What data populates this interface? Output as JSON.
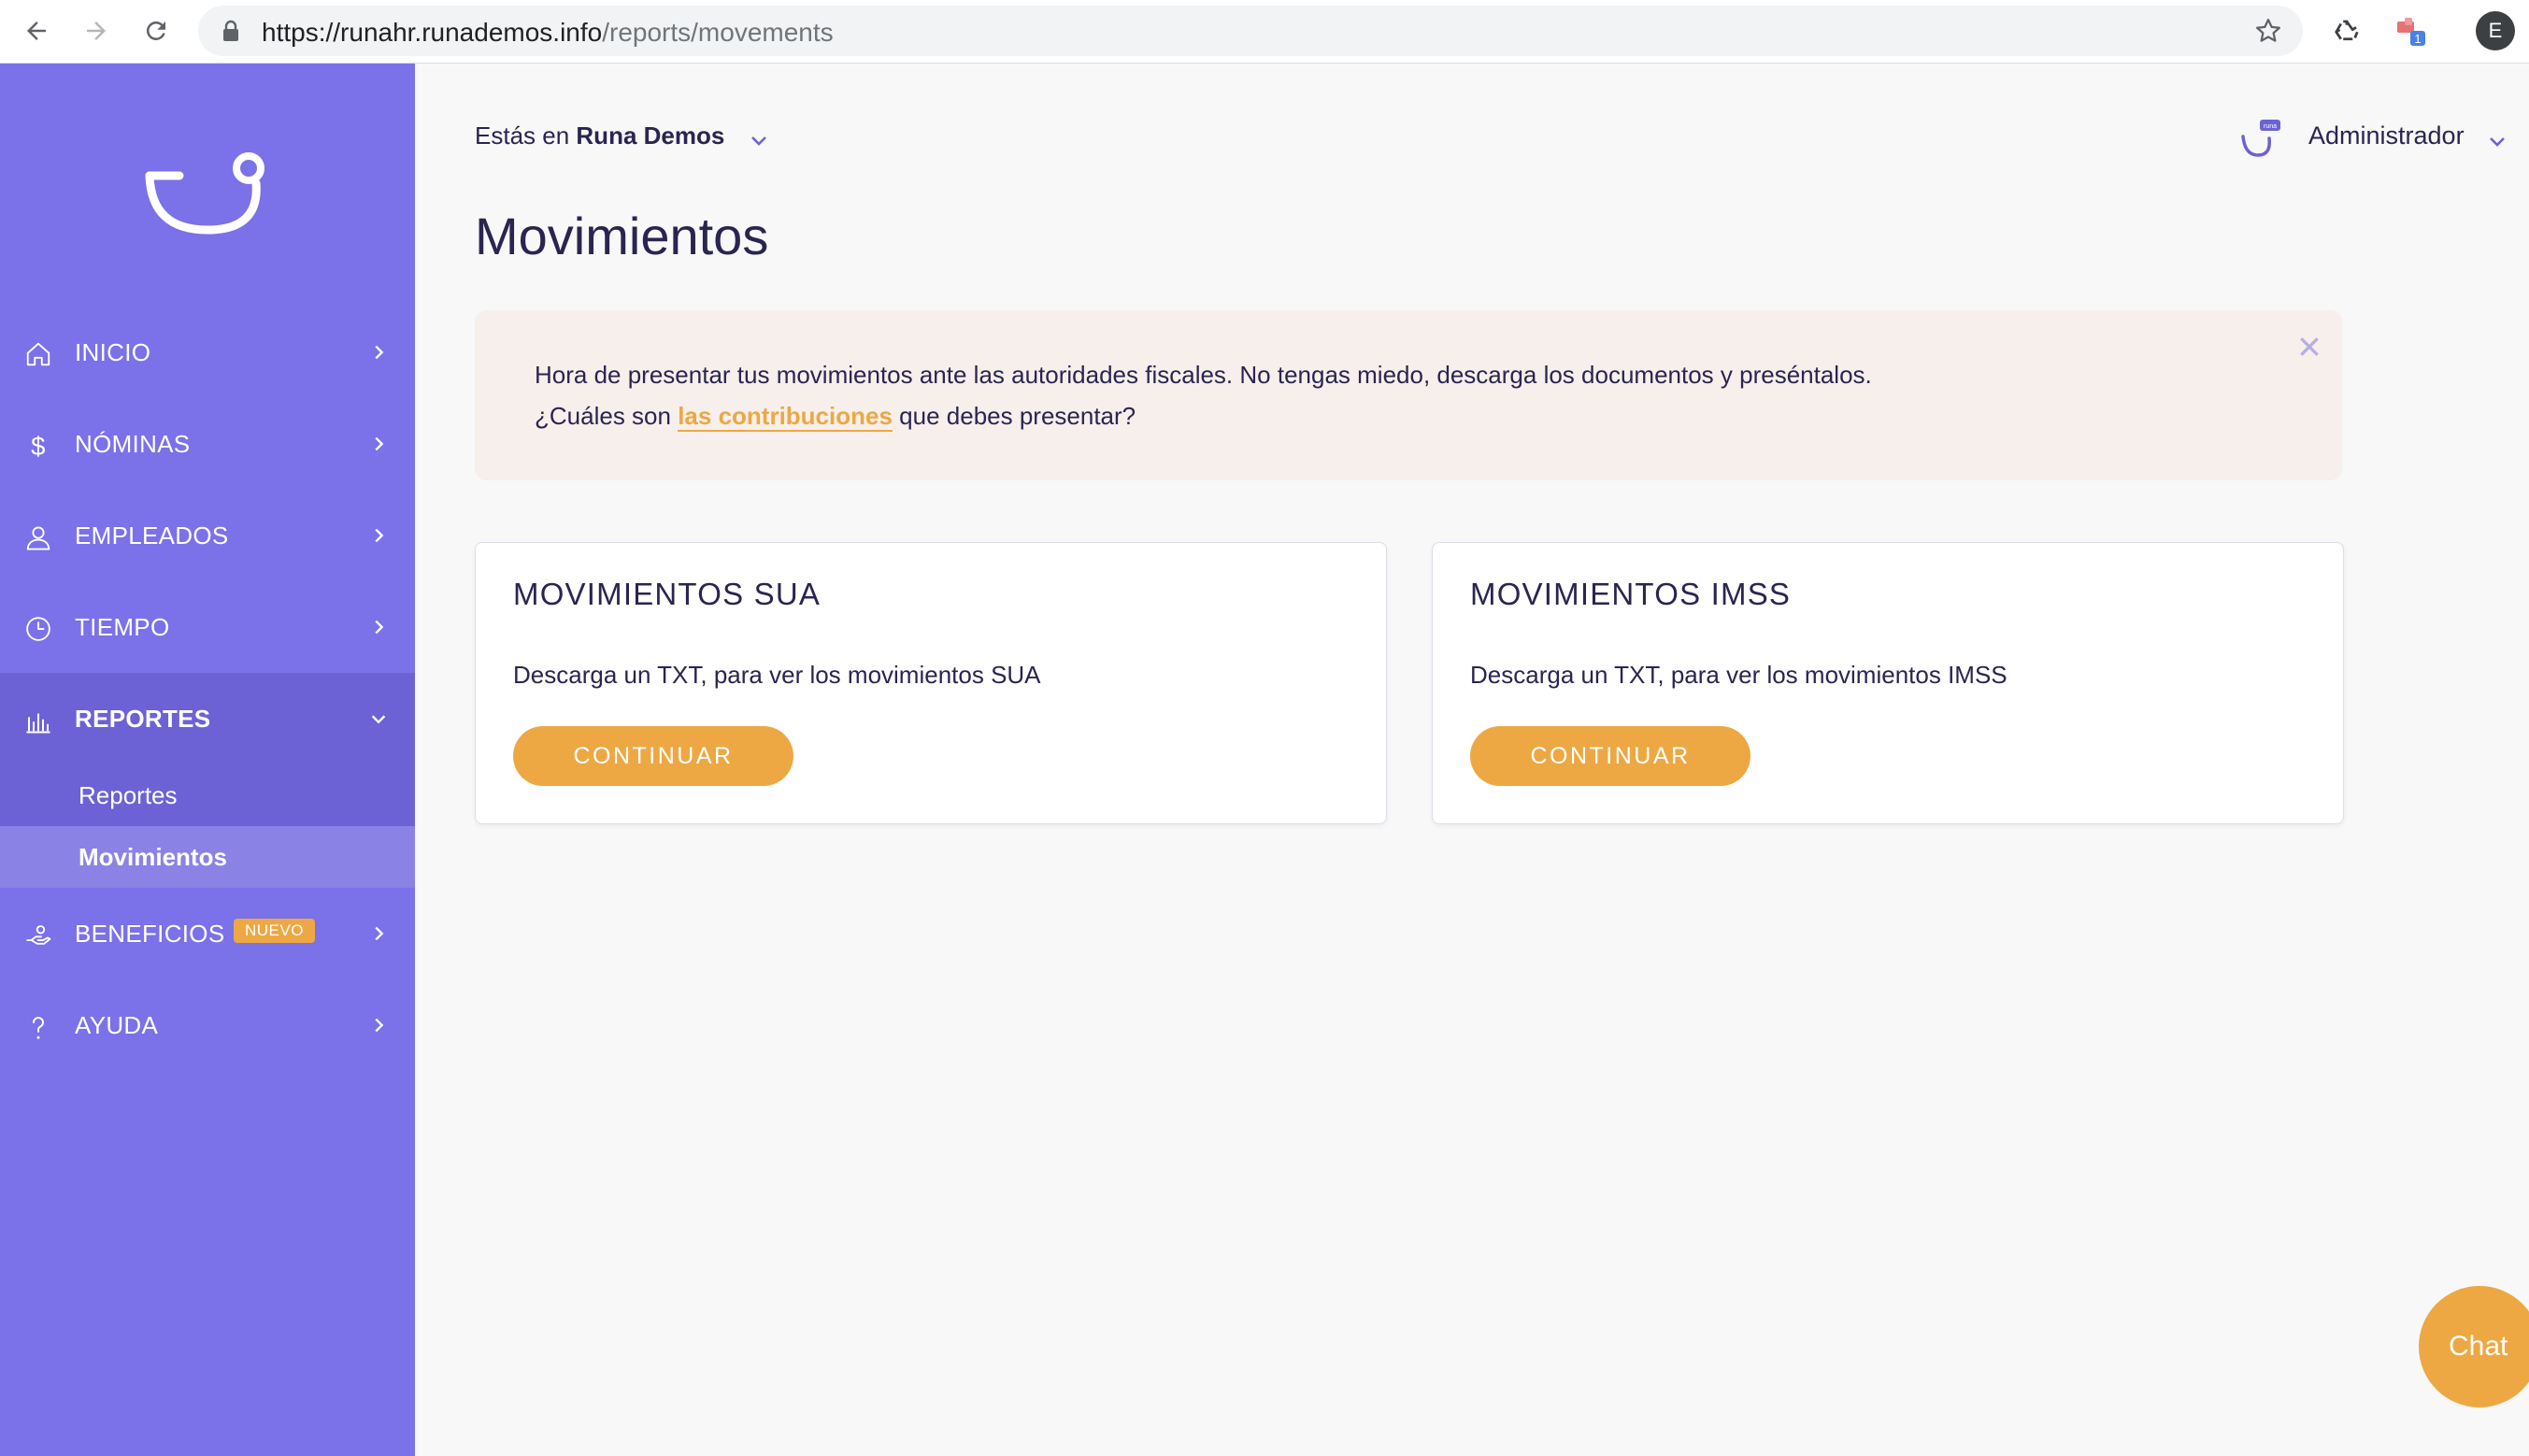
{
  "browser": {
    "url_host": "https://runahr.runademos.info",
    "url_path": "/reports/movements",
    "profile_initial": "E",
    "extension_badge": "1"
  },
  "sidebar": {
    "items": [
      {
        "label": "INICIO",
        "icon": "home-icon"
      },
      {
        "label": "NÓMINAS",
        "icon": "dollar-icon"
      },
      {
        "label": "EMPLEADOS",
        "icon": "person-icon"
      },
      {
        "label": "TIEMPO",
        "icon": "clock-icon"
      },
      {
        "label": "REPORTES",
        "icon": "bar-chart-icon",
        "expanded": true
      },
      {
        "label": "BENEFICIOS",
        "icon": "hand-icon",
        "badge": "NUEVO"
      },
      {
        "label": "AYUDA",
        "icon": "question-icon"
      }
    ],
    "reportes_sub": [
      {
        "label": "Reportes"
      },
      {
        "label": "Movimientos",
        "current": true
      }
    ]
  },
  "header": {
    "company_prefix": "Estás en",
    "company_name": "Runa Demos",
    "user_name": "Administrador"
  },
  "main": {
    "title": "Movimientos",
    "alert": {
      "line1": "Hora de presentar tus movimientos ante las autoridades fiscales. No tengas miedo, descarga los documentos y preséntalos.",
      "line2_prefix": "¿Cuáles son",
      "line2_link": "las contribuciones",
      "line2_suffix": "que debes presentar?"
    },
    "cards": [
      {
        "title": "MOVIMIENTOS SUA",
        "description": "Descarga un TXT, para ver los movimientos SUA",
        "button": "CONTINUAR"
      },
      {
        "title": "MOVIMIENTOS IMSS",
        "description": "Descarga un TXT, para ver los movimientos IMSS",
        "button": "CONTINUAR"
      }
    ]
  },
  "chat": {
    "label": "Chat"
  },
  "colors": {
    "sidebar": "#7b71e9",
    "sidebar_active": "#6c62d6",
    "accent": "#eda843",
    "text": "#2a2550",
    "alert_bg": "#f7efeb"
  }
}
